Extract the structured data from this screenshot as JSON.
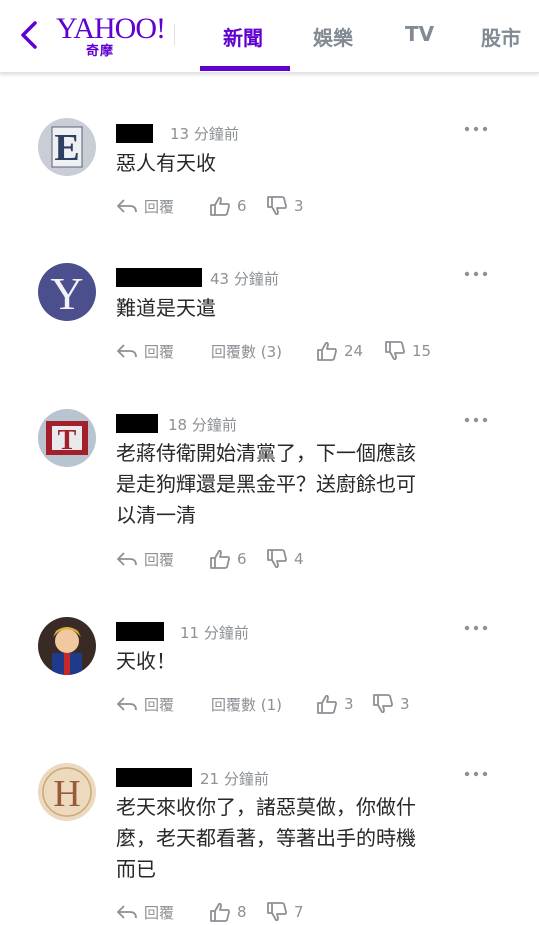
{
  "header": {
    "logo_main": "YAHOO!",
    "logo_sub": "奇摩",
    "tabs": [
      {
        "label": "新聞",
        "active": true
      },
      {
        "label": "娛樂",
        "active": false
      },
      {
        "label": "TV",
        "active": false
      },
      {
        "label": "股市",
        "active": false
      }
    ]
  },
  "colors": {
    "brand": "#6001d2",
    "muted": "#8c9196",
    "text": "#26282a"
  },
  "comments": [
    {
      "avatar_letter": "E",
      "avatar_icon": "letter-e-avatar",
      "time": "13 分鐘前",
      "text": "惡人有天收",
      "reply_label": "回覆",
      "replies_label": "",
      "likes": "6",
      "dislikes": "3"
    },
    {
      "avatar_letter": "Y",
      "avatar_icon": "letter-y-avatar",
      "time": "43 分鐘前",
      "text": "難道是天遣",
      "reply_label": "回覆",
      "replies_label": "回覆數 (3)",
      "likes": "24",
      "dislikes": "15"
    },
    {
      "avatar_letter": "T",
      "avatar_icon": "letter-t-avatar",
      "time": "18 分鐘前",
      "text": "老蔣侍衛開始清黨了，下一個應該\n是走狗輝還是黑金平？送廚餘也可\n以清一清",
      "reply_label": "回覆",
      "replies_label": "",
      "likes": "6",
      "dislikes": "4"
    },
    {
      "avatar_letter": "",
      "avatar_icon": "cartoon-avatar",
      "time": "11 分鐘前",
      "text": "天收！",
      "reply_label": "回覆",
      "replies_label": "回覆數 (1)",
      "likes": "3",
      "dislikes": "3"
    },
    {
      "avatar_letter": "H",
      "avatar_icon": "letter-h-avatar",
      "time": "21 分鐘前",
      "text": "老天來收你了，諸惡莫做，你做什\n麼，老天都看著，等著出手的時機\n而已",
      "reply_label": "回覆",
      "replies_label": "",
      "likes": "8",
      "dislikes": "7"
    }
  ]
}
